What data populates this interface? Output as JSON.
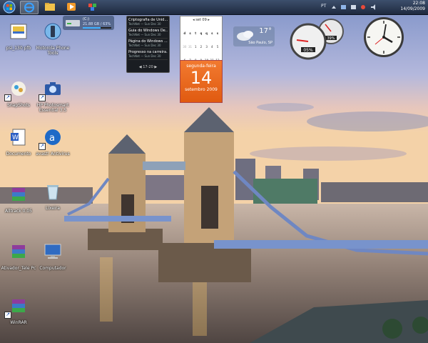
{
  "taskbar": {
    "tray": {
      "lang": "PT",
      "time": "22:08",
      "date": "14/09/2009"
    }
  },
  "desktop_icons": [
    {
      "label": "psi_130 pfb",
      "icon": "image-file-icon"
    },
    {
      "label": "Motorola Phone Tools",
      "icon": "phone-app-icon"
    },
    {
      "label": "SnapShots",
      "icon": "folder-icon"
    },
    {
      "label": "HP Photosmart Essential 3.5",
      "icon": "camera-app-icon"
    },
    {
      "label": "Documento",
      "icon": "document-icon"
    },
    {
      "label": "avast! Antivirus",
      "icon": "antivirus-icon"
    },
    {
      "label": "Alltrack 0.05",
      "icon": "winrar-archive-icon"
    },
    {
      "label": "Lixeira",
      "icon": "recycle-bin-icon"
    },
    {
      "label": "Ativador_Tele Pc",
      "icon": "winrar-archive-icon"
    },
    {
      "label": "Computador",
      "icon": "computer-icon"
    },
    {
      "label": "WinRAR",
      "icon": "winrar-archive-icon"
    }
  ],
  "gadgets": {
    "drive": {
      "label": "(C:)",
      "detail": "21.88 GB / 63%",
      "used_fraction": 0.63
    },
    "feed": {
      "items": [
        {
          "title": "Criptografia de Unid...",
          "sub": "TechNet — Sun Dec 30"
        },
        {
          "title": "Guia do Windows De...",
          "sub": "TechNet — Sun Dec 30"
        },
        {
          "title": "Página do Windows ...",
          "sub": "TechNet — Sun Dec 30"
        },
        {
          "title": "Progresso na carreira...",
          "sub": "TechNet — Sun Dec 30"
        }
      ],
      "nav": "17-20"
    },
    "calendar": {
      "month_header": "set 09",
      "weekdays": [
        "d",
        "s",
        "t",
        "q",
        "q",
        "s",
        "s"
      ],
      "days": [
        "30",
        "31",
        "1",
        "2",
        "3",
        "4",
        "5",
        "6",
        "7",
        "8",
        "9",
        "10",
        "11",
        "12",
        "13",
        "14",
        "15",
        "16",
        "17",
        "18",
        "19",
        "20",
        "21",
        "22",
        "23",
        "24",
        "25",
        "26",
        "27",
        "28",
        "29",
        "30",
        "1",
        "2",
        "3"
      ],
      "day_name": "segunda-feira",
      "day_number": "14",
      "month_year": "setembro 2009"
    },
    "weather": {
      "temp": "17°",
      "city": "São Paulo, SP"
    },
    "meter": {
      "cpu": "05%",
      "ram": "39%"
    }
  },
  "colors": {
    "taskbar": "#1e2a3f",
    "calendar_accent": "#e8651e",
    "sky": "#9fb0d6"
  }
}
